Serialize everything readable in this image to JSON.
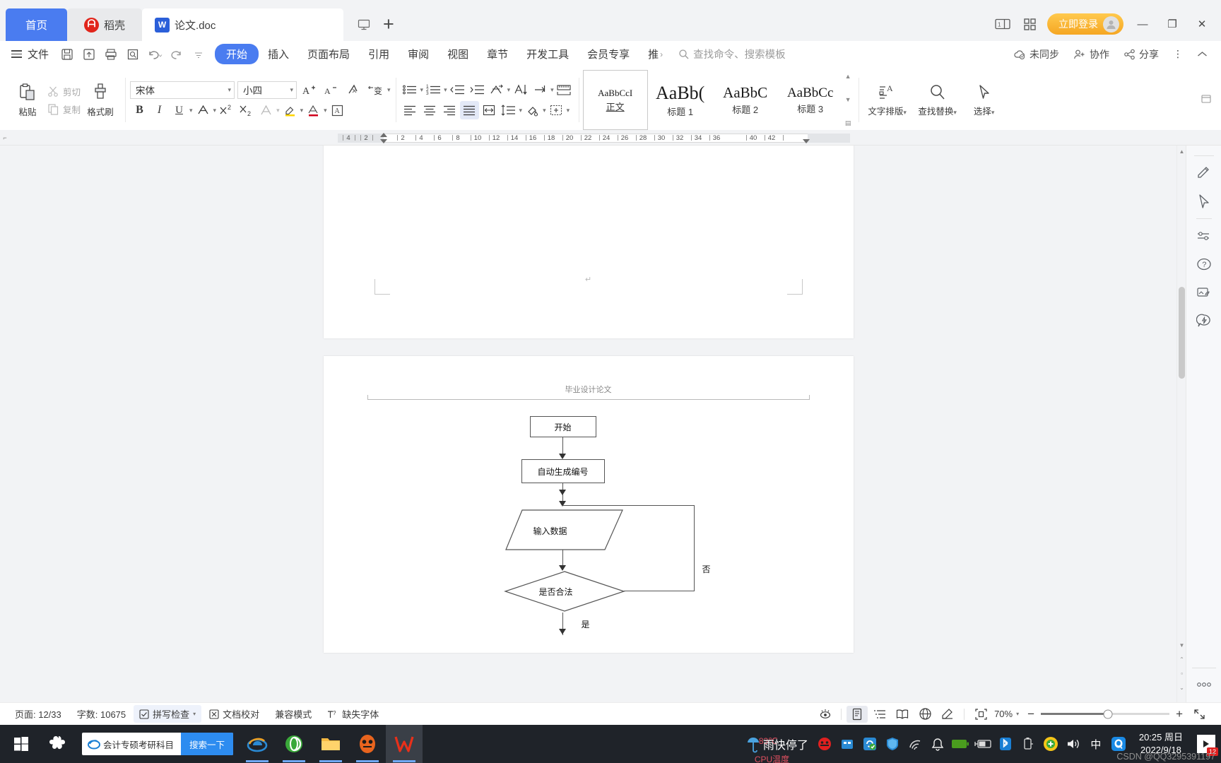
{
  "window": {
    "tabs": [
      {
        "label": "首页",
        "icon": "home-tab",
        "state": "home"
      },
      {
        "label": "稻壳",
        "icon": "docer-icon",
        "state": "inactive"
      },
      {
        "label": "论文.doc",
        "icon": "word-doc-icon",
        "state": "active"
      }
    ],
    "new_tab_label": "+",
    "login_label": "立即登录",
    "minimize": "—",
    "maximize": "❐",
    "close": "✕"
  },
  "menubar": {
    "file_label": "文件",
    "quick_icons": [
      "save-icon",
      "save-as-icon",
      "print-icon",
      "print-preview-icon",
      "undo-icon",
      "redo-icon",
      "customize-icon"
    ],
    "items": [
      {
        "label": "开始",
        "selected": true
      },
      {
        "label": "插入",
        "selected": false
      },
      {
        "label": "页面布局",
        "selected": false
      },
      {
        "label": "引用",
        "selected": false
      },
      {
        "label": "审阅",
        "selected": false
      },
      {
        "label": "视图",
        "selected": false
      },
      {
        "label": "章节",
        "selected": false
      },
      {
        "label": "开发工具",
        "selected": false
      },
      {
        "label": "会员专享",
        "selected": false
      },
      {
        "label": "推",
        "selected": false
      }
    ],
    "search_placeholder": "查找命令、搜索模板",
    "right": [
      {
        "label": "未同步",
        "icon": "cloud-sync-icon"
      },
      {
        "label": "协作",
        "icon": "collaborate-icon"
      },
      {
        "label": "分享",
        "icon": "share-icon"
      }
    ]
  },
  "ribbon": {
    "paste": "粘贴",
    "cut": "剪切",
    "copy": "复制",
    "format_painter": "格式刷",
    "font_family": "宋体",
    "font_size": "小四",
    "styles": [
      {
        "preview": "AaBbCcI",
        "name": "正文",
        "size": "13px",
        "selected": true
      },
      {
        "preview": "AaBb(",
        "name": "标题 1",
        "size": "27px",
        "selected": false
      },
      {
        "preview": "AaBbC",
        "name": "标题 2",
        "size": "22px",
        "selected": false
      },
      {
        "preview": "AaBbCc",
        "name": "标题 3",
        "size": "20px",
        "selected": false
      }
    ],
    "text_layout": "文字排版",
    "find_replace": "查找替换",
    "select": "选择"
  },
  "ruler": {
    "ticks": [
      "4",
      "2",
      "2",
      "4",
      "6",
      "8",
      "10",
      "12",
      "14",
      "16",
      "18",
      "20",
      "22",
      "24",
      "26",
      "28",
      "30",
      "32",
      "34",
      "36",
      "40",
      "42"
    ]
  },
  "document": {
    "header_text": "毕业设计论文",
    "para_mark": "↵",
    "flowchart": {
      "nodes": [
        {
          "id": "start",
          "label": "开始",
          "shape": "rect"
        },
        {
          "id": "autonum",
          "label": "自动生成编号",
          "shape": "rect"
        },
        {
          "id": "input",
          "label": "输入数据",
          "shape": "parallelogram"
        },
        {
          "id": "valid",
          "label": "是否合法",
          "shape": "diamond"
        }
      ],
      "edge_labels": [
        {
          "label": "否"
        },
        {
          "label": "是"
        }
      ]
    }
  },
  "rail": {
    "icons": [
      "pen-highlight-icon",
      "cursor-select-icon",
      "sliders-icon",
      "help-circle-icon",
      "image-tools-icon",
      "lightning-badge-icon",
      "more-options-icon"
    ]
  },
  "statusbar": {
    "page": "页面: 12/33",
    "words": "字数: 10675",
    "spellcheck": "拼写检查",
    "proofread": "文档校对",
    "compat_mode": "兼容模式",
    "missing_font": "缺失字体",
    "zoom": "70%",
    "view_icons": [
      "read-eye-icon",
      "print-layout-icon",
      "outline-icon",
      "reading-icon",
      "web-layout-icon",
      "edit-mark-icon",
      "fit-page-icon"
    ],
    "zoom_out": "−",
    "zoom_in": "+",
    "fullscreen": "fullscreen-icon"
  },
  "taskbar": {
    "start": "start-icon",
    "cortana": "cortana-icon",
    "search_text": "会计专硕考研科目",
    "search_button": "搜索一下",
    "apps": [
      "ie-browser-icon",
      "360-browser-icon",
      "file-explorer-icon",
      "fox-app-icon",
      "wps-icon"
    ],
    "weather_text": "雨快停了",
    "cpu_temp": "83℃",
    "cpu_label": "CPU温度",
    "tray_icons": [
      "no-disturb-icon",
      "usb-device-icon",
      "sync-app-icon",
      "security-shield-icon",
      "wifi-icon",
      "bell-icon",
      "battery-green-icon",
      "power-plug-icon",
      "bluetooth-icon",
      "usb-drive-icon",
      "antivirus-icon",
      "volume-icon"
    ],
    "ime": "中",
    "qq": "qq-icon",
    "time": "20:25 周日",
    "date": "2022/9/18",
    "notification_count": "12"
  },
  "watermark": "CSDN @QQ3295391197"
}
